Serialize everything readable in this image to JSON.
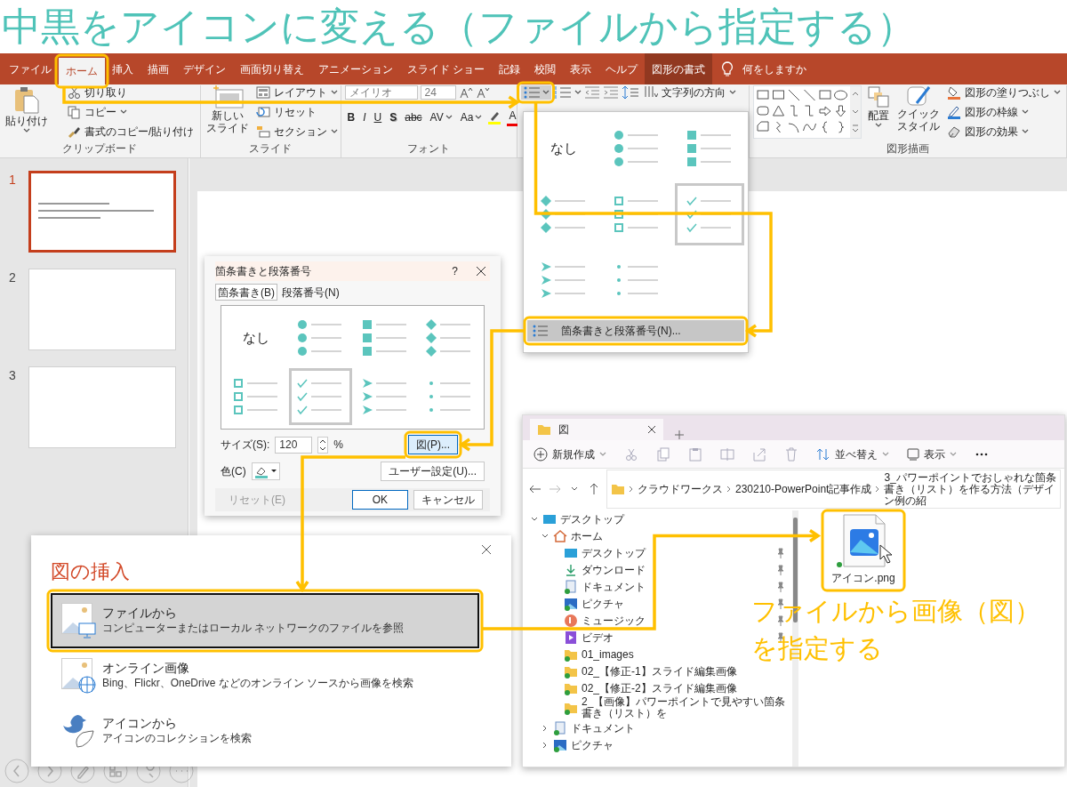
{
  "title": "中黒をアイコンに変える（ファイルから指定する）",
  "ribbon_tabs": [
    {
      "label": "ファイル",
      "selected": false,
      "kind": "tab"
    },
    {
      "label": "ホーム",
      "selected": true,
      "kind": "tab"
    },
    {
      "label": "挿入",
      "selected": false,
      "kind": "tab"
    },
    {
      "label": "描画",
      "selected": false,
      "kind": "tab"
    },
    {
      "label": "デザイン",
      "selected": false,
      "kind": "tab"
    },
    {
      "label": "画面切り替え",
      "selected": false,
      "kind": "tab"
    },
    {
      "label": "アニメーション",
      "selected": false,
      "kind": "tab"
    },
    {
      "label": "スライド ショー",
      "selected": false,
      "kind": "tab"
    },
    {
      "label": "記録",
      "selected": false,
      "kind": "tab"
    },
    {
      "label": "校閲",
      "selected": false,
      "kind": "tab"
    },
    {
      "label": "表示",
      "selected": false,
      "kind": "tab"
    },
    {
      "label": "ヘルプ",
      "selected": false,
      "kind": "tab"
    },
    {
      "label": "図形の書式",
      "selected": false,
      "kind": "contextual"
    }
  ],
  "tell_me": {
    "placeholder": "何をしますか"
  },
  "clipboard": {
    "label": "クリップボード",
    "paste": "貼り付け",
    "items": [
      "切り取り",
      "コピー",
      "書式のコピー/貼り付け"
    ]
  },
  "slides_group": {
    "label": "スライド",
    "new_slide": [
      "新しい",
      "スライド"
    ],
    "items": [
      "レイアウト",
      "リセット",
      "セクション"
    ]
  },
  "font": {
    "label": "フォント",
    "font_name": "メイリオ",
    "font_size": "24",
    "styles": [
      {
        "text": "B",
        "kind": "bold"
      },
      {
        "text": "I",
        "kind": "italic"
      },
      {
        "text": "U",
        "kind": "underline"
      },
      {
        "text": "S",
        "kind": "shadow"
      },
      {
        "text": "abc",
        "kind": "strike"
      },
      {
        "text": "AV",
        "kind": "spacing"
      },
      {
        "text": "Aa",
        "kind": "case"
      },
      {
        "text": "A",
        "kind": "font_color"
      }
    ]
  },
  "paragraph": {
    "text_direction": "文字列の方向"
  },
  "drawing": {
    "label": "図形描画",
    "arrange": "配置",
    "quick_styles": [
      "クイック",
      "スタイル"
    ],
    "items": [
      "図形の塗りつぶし",
      "図形の枠線",
      "図形の効果"
    ]
  },
  "thumbnails": [
    {
      "number": "1",
      "selected": true
    },
    {
      "number": "2",
      "selected": false
    },
    {
      "number": "3",
      "selected": false
    }
  ],
  "bullet_menu": {
    "options": [
      {
        "kind": "none",
        "label": "なし",
        "selected": false
      },
      {
        "kind": "circle",
        "selected": false
      },
      {
        "kind": "square",
        "selected": false
      },
      {
        "kind": "diamond",
        "selected": false
      },
      {
        "kind": "hollow-square",
        "selected": false
      },
      {
        "kind": "check",
        "selected": true
      },
      {
        "kind": "arrowhead",
        "selected": false
      },
      {
        "kind": "dot",
        "selected": false
      }
    ],
    "footer": {
      "label": "箇条書きと段落番号(N)...",
      "selected": true
    }
  },
  "bullets_dialog": {
    "title": "箇条書きと段落番号",
    "help": "?",
    "tabs": [
      {
        "label": "箇条書き(B)",
        "selected": true
      },
      {
        "label": "段落番号(N)",
        "selected": false
      }
    ],
    "options": [
      {
        "kind": "none",
        "label": "なし",
        "selected": false
      },
      {
        "kind": "circle",
        "selected": false
      },
      {
        "kind": "square",
        "selected": false
      },
      {
        "kind": "diamond",
        "selected": false
      },
      {
        "kind": "hollow-square",
        "selected": false
      },
      {
        "kind": "check",
        "selected": true
      },
      {
        "kind": "arrowhead",
        "selected": false
      },
      {
        "kind": "dot",
        "selected": false
      }
    ],
    "size_label": "サイズ(S):",
    "size_value": "120",
    "percent": "%",
    "picture_button": "図(P)...",
    "color_label": "色(C)",
    "custom_button": "ユーザー設定(U)...",
    "reset_button": {
      "label": "リセット(E)",
      "disabled": true
    },
    "ok_button": "OK",
    "cancel_button": "キャンセル"
  },
  "insert_picture": {
    "title": "図の挿入",
    "options": [
      {
        "kind": "file",
        "title": "ファイルから",
        "description": "コンピューターまたはローカル ネットワークのファイルを参照",
        "selected": true
      },
      {
        "kind": "online",
        "title": "オンライン画像",
        "description": "Bing、Flickr、OneDrive などのオンライン ソースから画像を検索",
        "selected": false
      },
      {
        "kind": "icons",
        "title": "アイコンから",
        "description": "アイコンのコレクションを検索",
        "selected": false
      }
    ]
  },
  "explorer": {
    "tab_title": "図",
    "new_label": "新規作成",
    "sort_label": "並べ替え",
    "view_label": "表示",
    "breadcrumb": [
      "クラウドワークス",
      "230210-PowerPoint記事作成",
      "3_パワーポイントでおしゃれな箇条書き（リスト）を作る方法（デザイン例の紹"
    ],
    "tree": [
      {
        "label": "デスクトップ",
        "kind": "desktop",
        "expanded": true,
        "children": [
          {
            "label": "ホーム",
            "kind": "home",
            "expanded": true,
            "children": [
              {
                "label": "デスクトップ",
                "kind": "desktop",
                "pinned": true
              },
              {
                "label": "ダウンロード",
                "kind": "download",
                "pinned": true
              },
              {
                "label": "ドキュメント",
                "kind": "documents",
                "pinned": true
              },
              {
                "label": "ピクチャ",
                "kind": "pictures",
                "pinned": true
              },
              {
                "label": "ミュージック",
                "kind": "music",
                "pinned": true
              },
              {
                "label": "ビデオ",
                "kind": "videos",
                "pinned": true
              },
              {
                "label": "01_images",
                "kind": "folder",
                "pinned": false
              },
              {
                "label": "02_【修正-1】スライド編集画像",
                "kind": "folder",
                "pinned": false
              },
              {
                "label": "02_【修正-2】スライド編集画像",
                "kind": "folder",
                "pinned": false
              },
              {
                "label": "2_【画像】パワーポイントで見やすい箇条書き（リスト）を",
                "kind": "folder",
                "pinned": false
              }
            ]
          },
          {
            "label": "ドキュメント",
            "kind": "documents",
            "expanded": false,
            "pinned": false
          },
          {
            "label": "ピクチャ",
            "kind": "pictures",
            "expanded": false,
            "pinned": false
          }
        ]
      }
    ],
    "files": [
      {
        "name": "アイコン.png"
      }
    ]
  },
  "callout": [
    "ファイルから画像（図）",
    "を指定する"
  ]
}
